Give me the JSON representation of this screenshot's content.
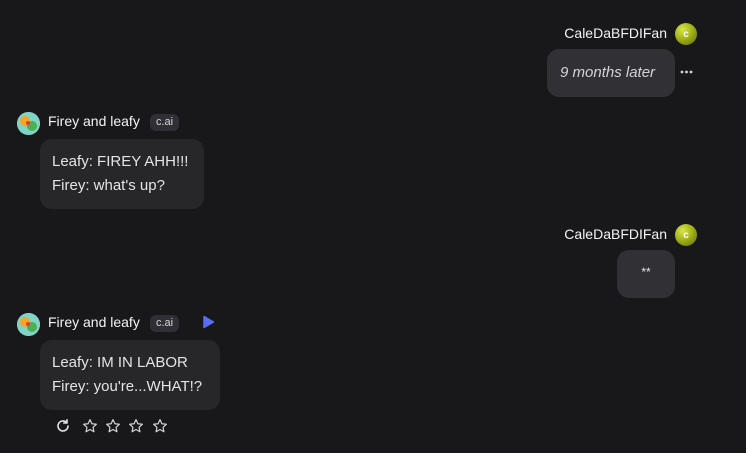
{
  "messages": [
    {
      "role": "user",
      "username": "CaleDaBFDIFan",
      "avatar_initial": "c",
      "lines": [
        "9 months later"
      ],
      "italic": true,
      "menu_icon": "more-horizontal-icon"
    },
    {
      "role": "bot",
      "username": "Firey and leafy",
      "badge": "c.ai",
      "lines": [
        "Leafy: FIREY AHH!!!",
        "Firey: what's up?"
      ]
    },
    {
      "role": "user",
      "username": "CaleDaBFDIFan",
      "avatar_initial": "c",
      "lines": [
        "**"
      ]
    },
    {
      "role": "bot",
      "username": "Firey and leafy",
      "badge": "c.ai",
      "play_icon": "play-icon",
      "lines": [
        "Leafy: IM IN LABOR",
        "Firey: you're...WHAT!?"
      ],
      "actions": {
        "regenerate_icon": "refresh-icon",
        "rating_icons": [
          "star-icon",
          "star-icon",
          "star-icon",
          "star-icon"
        ]
      }
    }
  ],
  "colors": {
    "background": "#18181b",
    "bubble": "#27272a",
    "accent": "#5b6cf5"
  }
}
